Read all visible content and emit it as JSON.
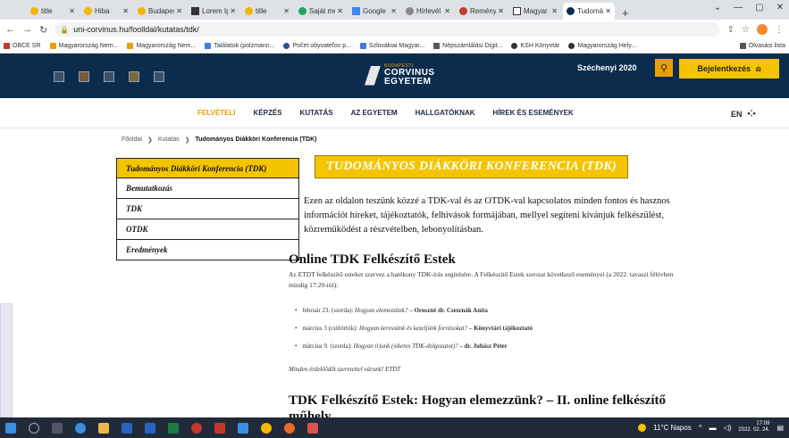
{
  "browser": {
    "tabs": [
      {
        "label": "title",
        "active": false
      },
      {
        "label": "Hiba",
        "active": false
      },
      {
        "label": "Budapest",
        "active": false
      },
      {
        "label": "Lorem Ip",
        "active": false
      },
      {
        "label": "title",
        "active": false
      },
      {
        "label": "Saját me",
        "active": false
      },
      {
        "label": "Google",
        "active": false
      },
      {
        "label": "Hírlevél",
        "active": false
      },
      {
        "label": "Remény",
        "active": false
      },
      {
        "label": "Magyar",
        "active": false
      },
      {
        "label": "Tudomán",
        "active": true
      }
    ],
    "new_tab": "+",
    "url": "uni-corvinus.hu/foolldal/kutatas/tdk/",
    "bookmarks": [
      "OBCE SR",
      "Magyarország Nem...",
      "Magyarország Nem...",
      "Találatok (polzmann...",
      "Počet obyvateľov p...",
      "Szlovákiai Magyar...",
      "Népszámlálási Digit...",
      "KSH Könyvtár",
      "Magyarország Hely..."
    ],
    "bookmarks_right": "Olvasási lista"
  },
  "site": {
    "logo_small": "BUDAPESTI",
    "logo_big1": "CORVINUS",
    "logo_big2": "EGYETEM",
    "szechenyi": "Széchenyi 2020",
    "login": "Bejelentkezés",
    "nav": [
      "FELVÉTELI",
      "KÉPZÉS",
      "KUTATÁS",
      "AZ EGYETEM",
      "HALLGATÓKNAK",
      "HÍREK ÉS ESEMÉNYEK"
    ],
    "lang": "EN"
  },
  "breadcrumb": {
    "home": "Főoldal",
    "sep": "❯",
    "parent": "Kutatás",
    "current": "Tudományos Diákköri Konferencia (TDK)"
  },
  "sidebar": {
    "items": [
      "Tudományos Diákköri Konferencia (TDK)",
      "Bemutatkozás",
      "TDK",
      "OTDK",
      "Eredmények"
    ]
  },
  "content": {
    "title": "TUDOMÁNYOS DIÁKKÖRI KONFERENCIA (TDK)",
    "intro": "Ezen az oldalon teszünk közzé a TDK-val és az OTDK-val kapcsolatos minden fontos és hasznos információt híreket, tájékoztatók, felhívások formájában, mellyel segíteni kívánjuk felkészülést, közreműködést a részvételben, lebonyolításban.",
    "h2": "Online TDK Felkészítő Estek",
    "p1": "Az ETDT felkészítő esteket szervez a hatékony TDK-írás segítésére. A Felkészítő Estek sorozat következő eseményei (a 2022. tavaszi félévben mindig 17:20-tól):",
    "events": [
      {
        "date": "február 23. (szerda):",
        "title": "Hogyan elemezzünk?",
        "speaker": "– Oroszné dr. Csesznák Anita"
      },
      {
        "date": "március 3 (csütörtök):",
        "title": "Hogyan keressünk és kezeljünk forrásokat?",
        "speaker": "– Könyvtári tájékoztató"
      },
      {
        "date": "március 9. (szerda):",
        "title": "Hogyan írjunk (sikeres TDK-dolgozatot)?",
        "speaker": "– dr. Juhász Péter"
      }
    ],
    "note": "Minden érdeklődőt szeretettel várunk! ETDT",
    "h2b": "TDK Felkészítő Estek: Hogyan elemezzünk? – II. online felkészítő műhely"
  },
  "taskbar": {
    "weather": "11°C Napos",
    "time": "17:09",
    "date": "2022. 02. 24."
  },
  "colors": {
    "header_bg": "#0c2c4e",
    "accent": "#f5c400",
    "nav_active": "#e8a000"
  }
}
